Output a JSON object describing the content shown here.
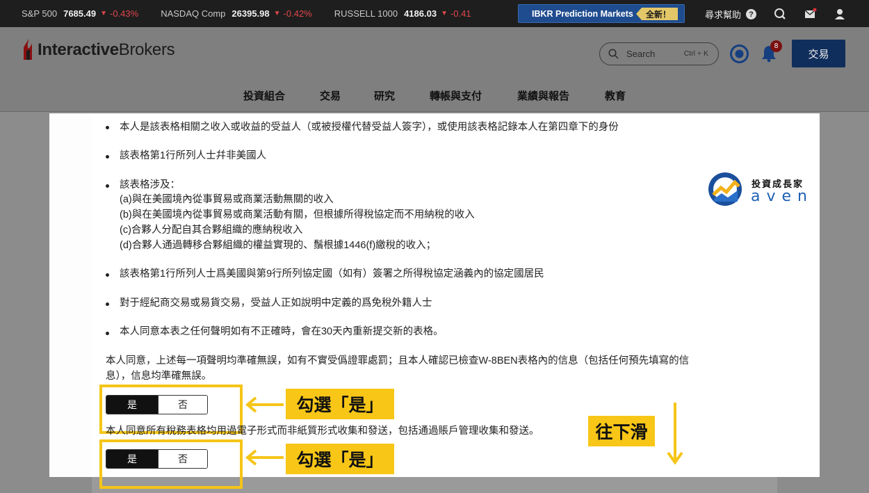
{
  "ticker": [
    {
      "name": "S&P 500",
      "value": "7685.49",
      "change": "-0.43%"
    },
    {
      "name": "NASDAQ Comp",
      "value": "26395.98",
      "change": "-0.42%"
    },
    {
      "name": "RUSSELL 1000",
      "value": "4186.03",
      "change": "-0.41"
    }
  ],
  "promo": {
    "label": "IBKR Prediction Markets",
    "tag": "全新！"
  },
  "topbar": {
    "help_label": "尋求幫助",
    "help_icon": "question-icon",
    "icons": [
      "chat-icon",
      "mail-icon",
      "user-icon"
    ]
  },
  "header": {
    "logo_bold": "Interactive",
    "logo_rest": "Brokers",
    "search_placeholder": "Search",
    "search_shortcut": "Ctrl + K",
    "notification_count": "8",
    "trade_button": "交易",
    "nav": [
      "投資組合",
      "交易",
      "研究",
      "轉帳與支付",
      "業績與報告",
      "教育"
    ]
  },
  "form": {
    "bullets": [
      "本人是該表格相關之收入或收益的受益人（或被授權代替受益人簽字），或使用該表格記錄本人在第四章下的身份",
      "該表格第1行所列人士幷非美國人",
      "該表格涉及：",
      "該表格第1行所列人士爲美國與第9行所列協定國（如有）簽署之所得稅協定涵義內的協定國居民",
      "對于經紀商交易或易貨交易，受益人正如說明中定義的爲免稅外籍人士",
      "本人同意本表之任何聲明如有不正確時，會在30天內重新提交新的表格。"
    ],
    "sub_items": [
      "(a)與在美國境內從事貿易或商業活動無關的收入",
      "(b)與在美國境內從事貿易或商業活動有關，但根據所得稅協定而不用納稅的收入",
      "(c)合夥人分配自其合夥組織的應納稅收入",
      "(d)合夥人通過轉移合夥組織的權益實現的、鬚根據1446(f)繳稅的收入；"
    ],
    "agreement_1_line1": "本人同意，上述每一項聲明均準確無誤，如有不實受僞證罪處罰；且本人確認已檢查W-8BEN表格內的信息（包括任何預先填寫的信",
    "agreement_1_line2": "息），信息均準確無誤。",
    "agreement_2": "本人同意所有稅務表格均用過電子形式而非紙質形式收集和發送，包括通過賬戶管理收集和發送。",
    "toggle_yes": "是",
    "toggle_no": "否"
  },
  "annotations": {
    "callout_1": "勾選「是」",
    "callout_2": "勾選「是」",
    "scroll_hint": "往下滑",
    "highlight_color": "#f5c518"
  },
  "watermark": {
    "title": "投資成長家",
    "name": "aven"
  }
}
